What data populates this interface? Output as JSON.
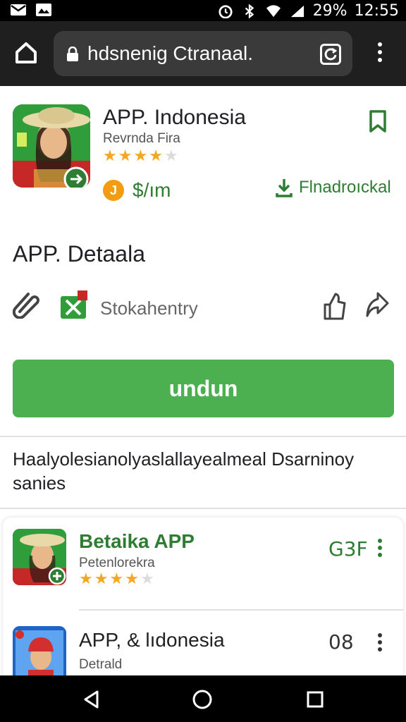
{
  "status_bar": {
    "battery": "29%",
    "time": "12:55"
  },
  "browser": {
    "url": "hdsnenig Ctranaal.",
    "tabs_count": ""
  },
  "app": {
    "title": "APP. Indonesia",
    "developer": "Revrnda Fira",
    "rating_stars": 3.5,
    "price": "$/ım",
    "coin_label": "J",
    "download_label": "Flnadroıckal"
  },
  "details": {
    "title": "APP. Detaala",
    "category_label": "Stokahentry"
  },
  "install_button": "undun",
  "description": "Haalyolesianolyaslallayealmeal Dsarninoy sanies",
  "similar": [
    {
      "title": "Betaika APP",
      "subtitle": "Petenlorekra",
      "rating_stars": 4,
      "meta": "G3F"
    },
    {
      "title": "APP, & lıdonesia",
      "subtitle": "Detrald",
      "meta": "08"
    }
  ],
  "colors": {
    "accent_green": "#4caf50",
    "dark_green": "#2e7d32",
    "star": "#f5a623"
  }
}
